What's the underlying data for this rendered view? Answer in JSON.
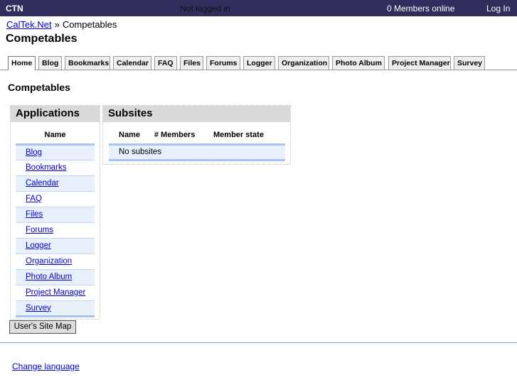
{
  "topbar": {
    "brand": "CTN",
    "status": "Not logged in",
    "members": "0 Members online",
    "login": "Log In"
  },
  "breadcrumb": {
    "home": "CalTek.Net",
    "sep": "»",
    "current": "Competables"
  },
  "title": "Competables",
  "tabs": [
    "Home",
    "Blog",
    "Bookmarks",
    "Calendar",
    "FAQ",
    "Files",
    "Forums",
    "Logger",
    "Organization",
    "Photo Album",
    "Project Manager",
    "Survey"
  ],
  "subtitle": "Competables",
  "applications": {
    "heading": "Applications",
    "col": "Name",
    "items": [
      "Blog",
      "Bookmarks",
      "Calendar",
      "FAQ",
      "Files",
      "Forums",
      "Logger",
      "Organization",
      "Photo Album",
      "Project Manager",
      "Survey"
    ]
  },
  "subsites": {
    "heading": "Subsites",
    "cols": [
      "Name",
      "# Members",
      "Member state"
    ],
    "empty": "No subsites"
  },
  "sitemap_button": "User's Site Map",
  "change_language": "Change language"
}
